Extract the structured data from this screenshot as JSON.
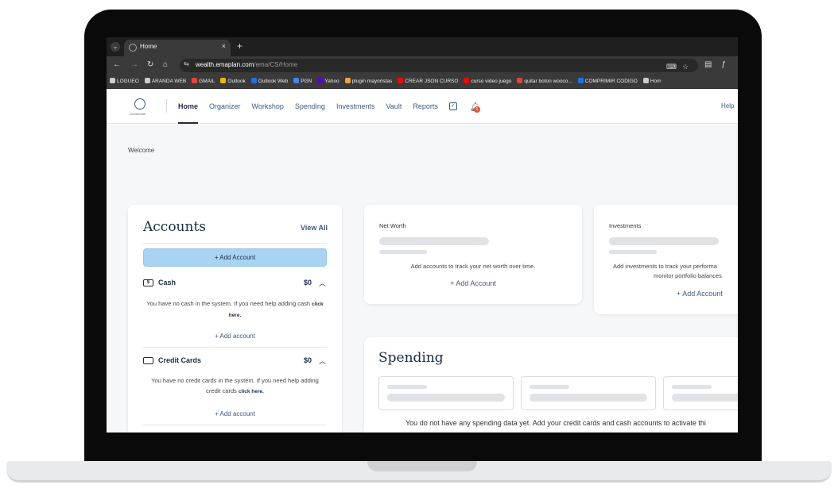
{
  "browser": {
    "tab_title": "Home",
    "tab_close": "×",
    "new_tab": "+",
    "url_host": "wealth.emaplan.com",
    "url_path": "/ema/CS/Home",
    "bookmarks": [
      {
        "label": "LOGUEO",
        "color": "#cccccc"
      },
      {
        "label": "ARANDA WEB",
        "color": "#cccccc"
      },
      {
        "label": "GMAIL",
        "color": "#ea4335"
      },
      {
        "label": "Outlook",
        "color": "#f4b400"
      },
      {
        "label": "Outlook Web",
        "color": "#1a73e8"
      },
      {
        "label": "PGN",
        "color": "#4285f4"
      },
      {
        "label": "Yahoo",
        "color": "#6001d2"
      },
      {
        "label": "plugin mayoristas",
        "color": "#f2a33a"
      },
      {
        "label": "CREAR JSON CURSO",
        "color": "#ff0000"
      },
      {
        "label": "curso video juego",
        "color": "#ff0000"
      },
      {
        "label": "quitar boton wooco...",
        "color": "#e94235"
      },
      {
        "label": "COMPRIMIR CODIGO",
        "color": "#1a73e8"
      },
      {
        "label": "Hom",
        "color": "#cccccc"
      }
    ]
  },
  "app": {
    "logo_text": "GeoWealth",
    "nav": [
      "Home",
      "Organizer",
      "Workshop",
      "Spending",
      "Investments",
      "Vault",
      "Reports"
    ],
    "notifications": "1",
    "help": "Help",
    "welcome": "Welcome"
  },
  "accounts": {
    "title": "Accounts",
    "view_all": "View All",
    "add_account": "+ Add Account",
    "cash": {
      "name": "Cash",
      "amount": "$0",
      "message": "You have no cash in the system. If you need help adding cash",
      "link": "click here.",
      "add": "+ Add account"
    },
    "credit": {
      "name": "Credit Cards",
      "amount": "$0",
      "message": "You have no credit cards in the system. If you need help adding credit cards",
      "link": "click here.",
      "add": "+ Add account"
    }
  },
  "networth": {
    "title": "Net Worth",
    "message": "Add accounts to track your net worth over time.",
    "add": "+ Add Account"
  },
  "investments": {
    "title": "Investments",
    "message_line1": "Add investments to track your performa",
    "message_line2": "monitor portfolio balances",
    "add": "+ Add Account"
  },
  "spending": {
    "title": "Spending",
    "message": "You do not have any spending data yet. Add your credit cards and cash accounts to activate thi"
  }
}
